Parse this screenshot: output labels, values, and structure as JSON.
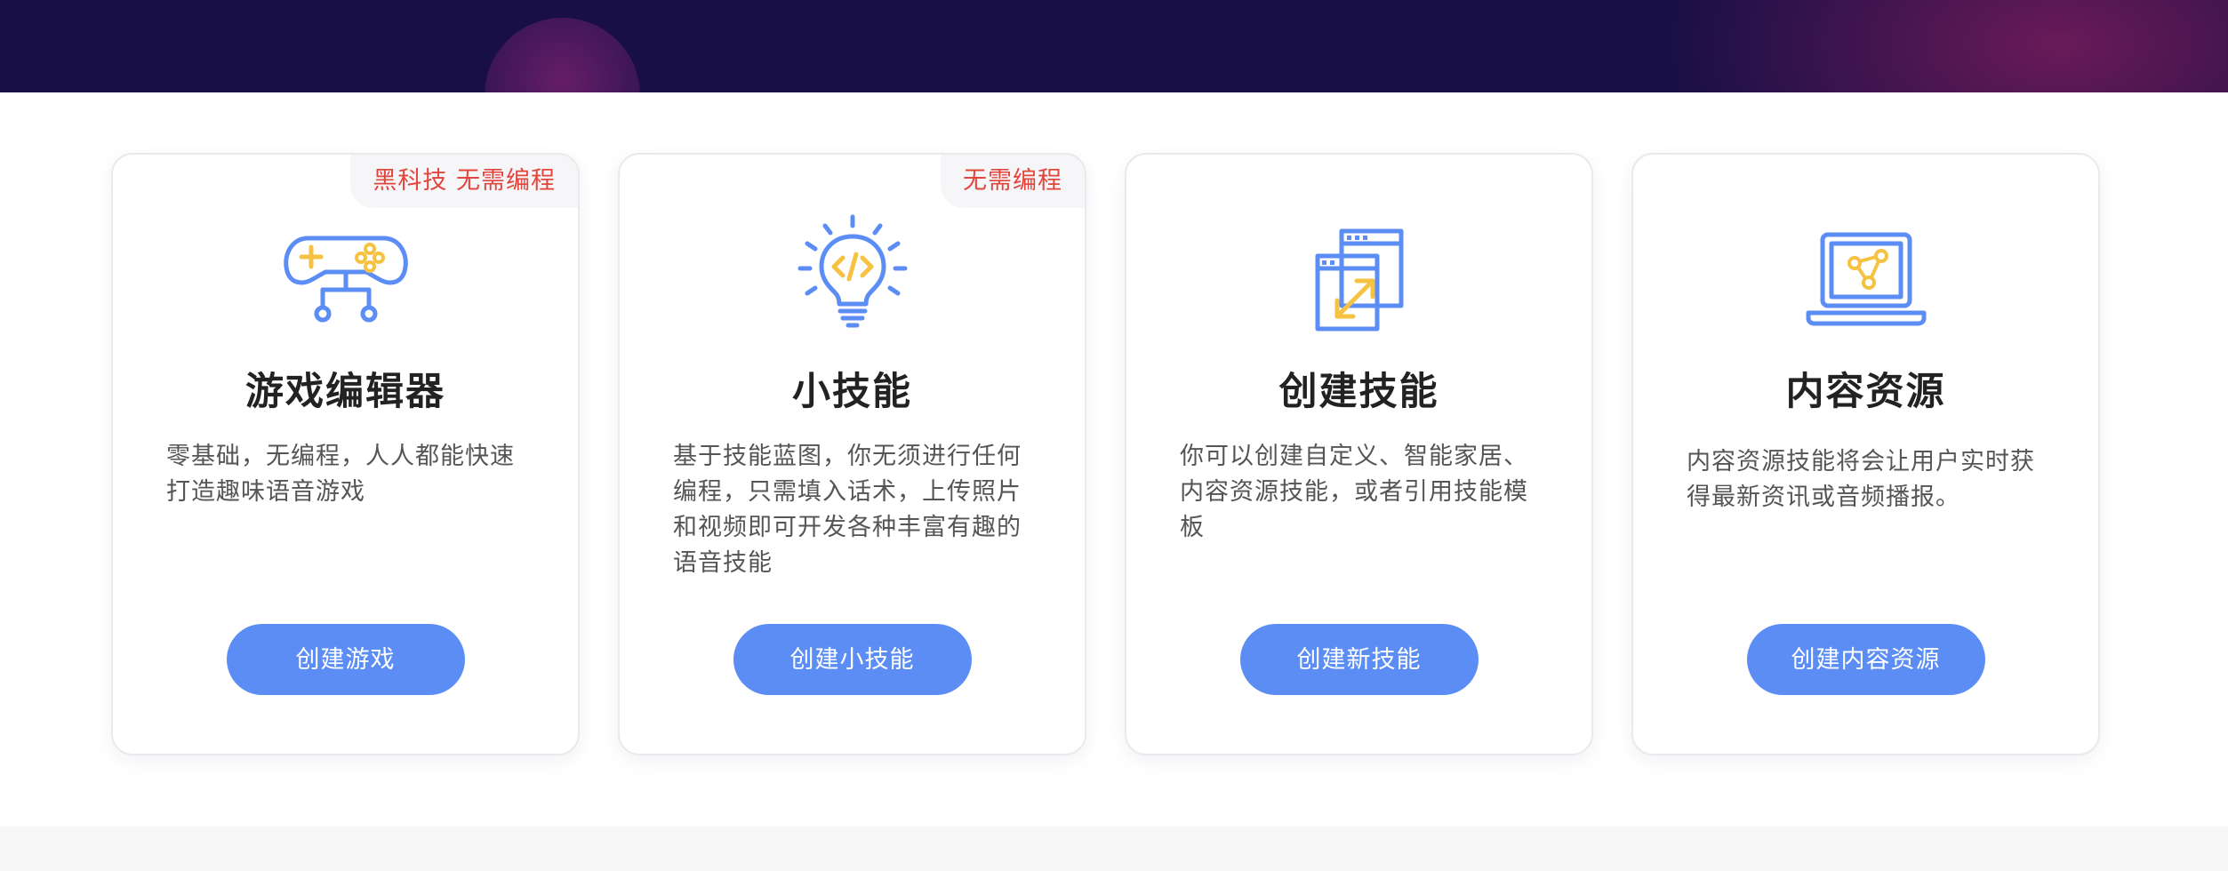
{
  "colors": {
    "banner_bg": "#170f45",
    "accent": "#5b8df5",
    "icon_primary": "#5b8df5",
    "icon_secondary": "#f5c242",
    "badge_text": "#e2453c"
  },
  "cards": [
    {
      "badge": "黑科技 无需编程",
      "icon": "gamepad-icon",
      "title": "游戏编辑器",
      "description": "零基础，无编程，人人都能快速打造趣味语音游戏",
      "button": "创建游戏"
    },
    {
      "badge": "无需编程",
      "icon": "lightbulb-code-icon",
      "title": "小技能",
      "description": "基于技能蓝图，你无须进行任何编程，只需填入话术，上传照片和视频即可开发各种丰富有趣的语音技能",
      "button": "创建小技能"
    },
    {
      "icon": "window-resize-icon",
      "title": "创建技能",
      "description": "你可以创建自定义、智能家居、内容资源技能，或者引用技能模板",
      "button": "创建新技能"
    },
    {
      "icon": "laptop-share-icon",
      "title": "内容资源",
      "description": "内容资源技能将会让用户实时获得最新资讯或音频播报。",
      "button": "创建内容资源"
    }
  ]
}
